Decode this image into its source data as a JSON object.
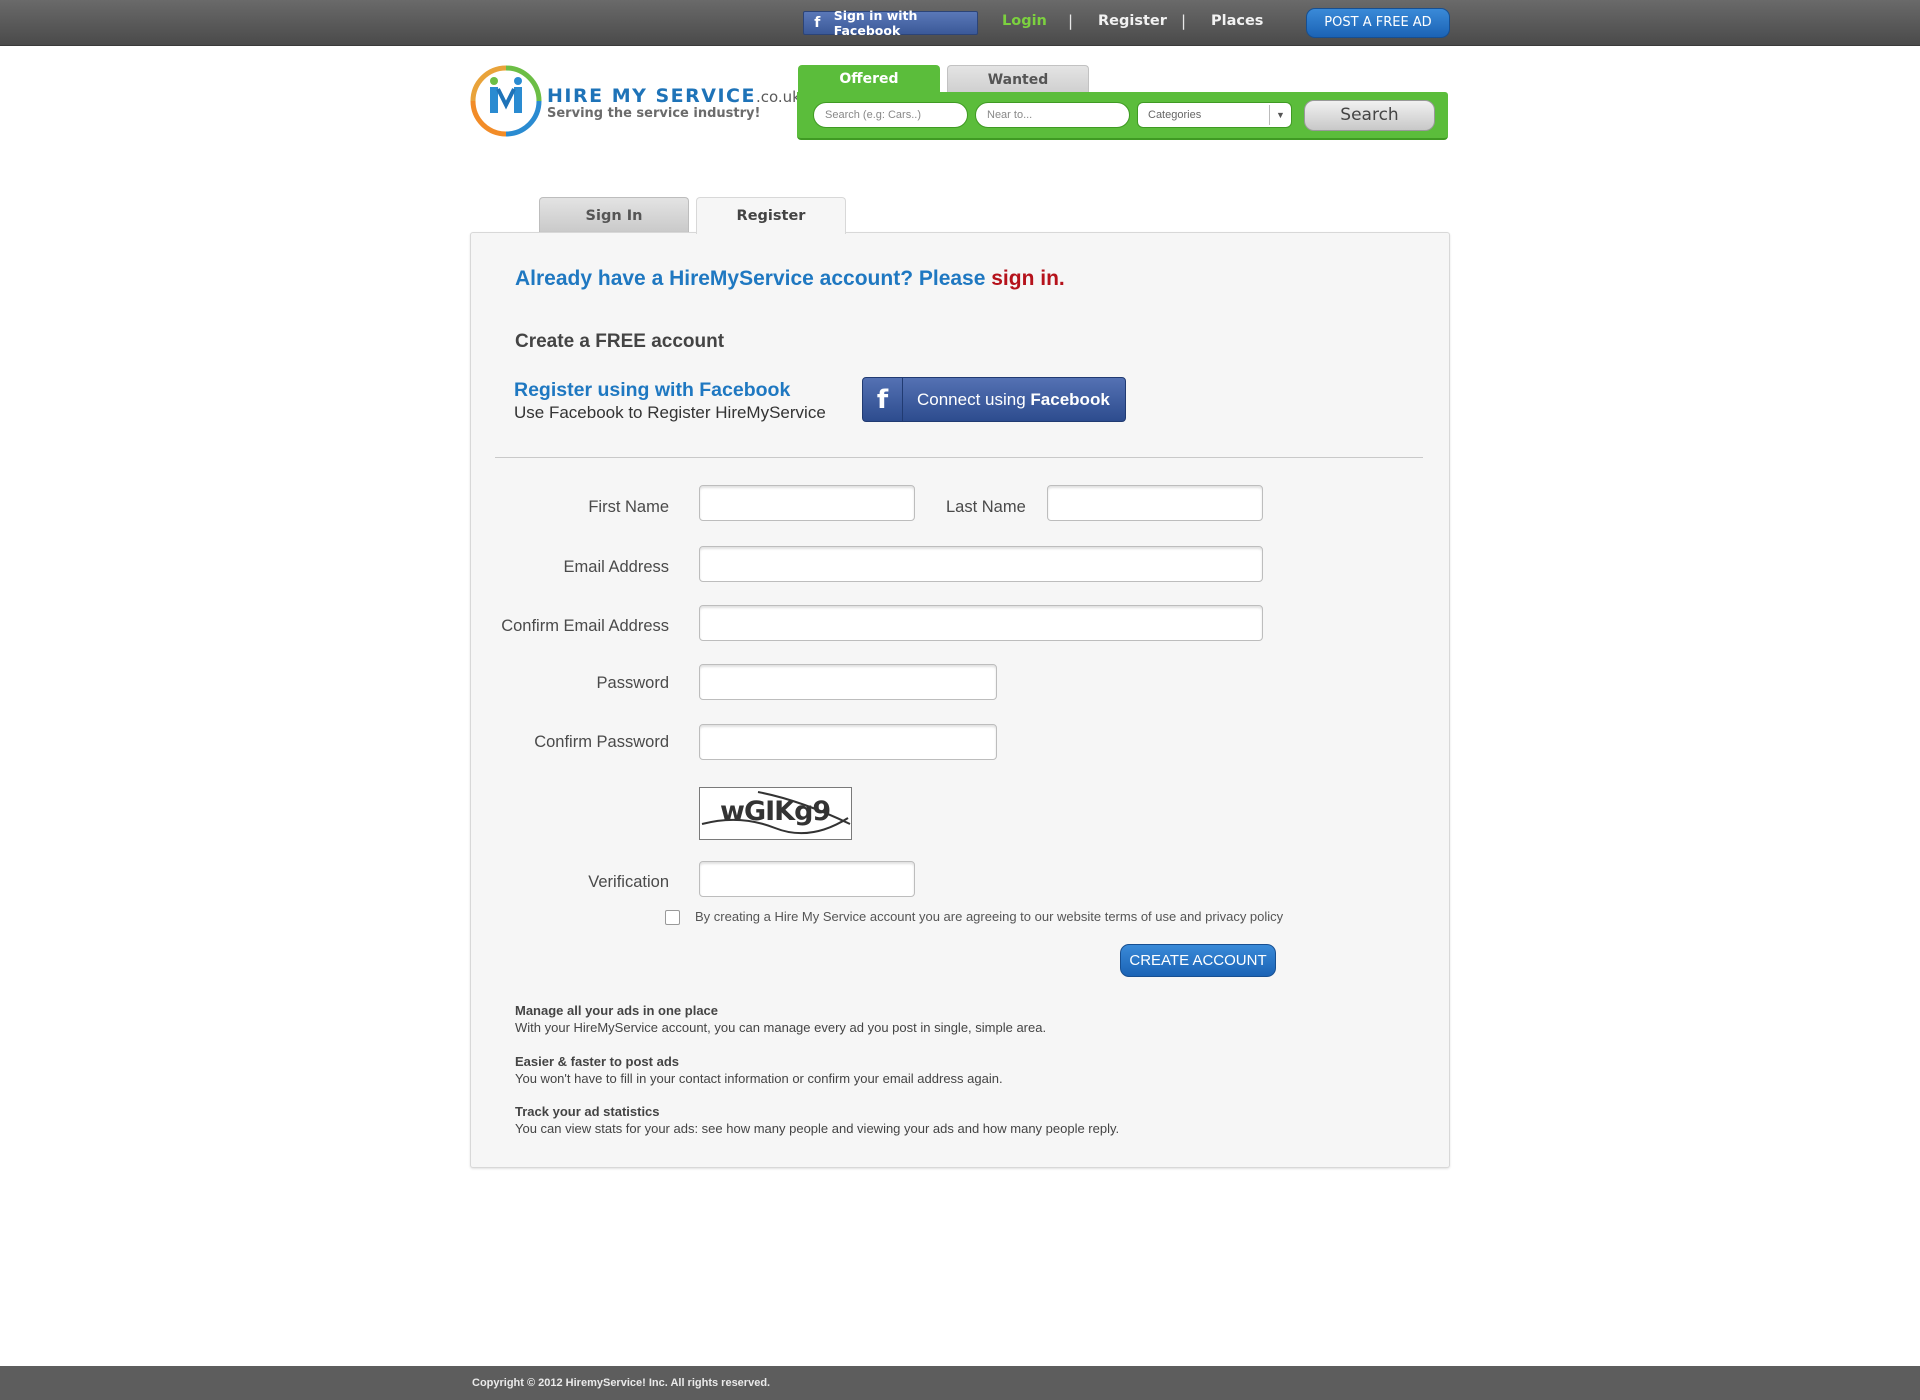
{
  "topbar": {
    "fb_signin_label": "Sign in with Facebook",
    "nav": [
      "Login",
      "Register",
      "Places"
    ],
    "separators": [
      "|",
      "|"
    ],
    "post_ad_label": "POST A FREE AD"
  },
  "logo": {
    "name": "HIRE MY SERVICE",
    "domain": ".co.uk",
    "tagline": "Serving the service industry!"
  },
  "search": {
    "tabs": [
      "Offered",
      "Wanted"
    ],
    "keyword_placeholder": "Search (e.g: Cars..)",
    "location_placeholder": "Near to...",
    "category_value": "Categories",
    "button_label": "Search"
  },
  "page_tabs": [
    "Sign In",
    "Register"
  ],
  "form": {
    "already_prefix": "Already have a HireMyService account? Please ",
    "already_link": "sign in.",
    "create_title": "Create a FREE account",
    "fb_title": "Register using with Facebook",
    "fb_subtitle": "Use Facebook to Register HireMyService",
    "fb_connect_prefix": "Connect using",
    "fb_connect_brand": "Facebook",
    "labels": {
      "first_name": "First Name",
      "last_name": "Last Name",
      "email": "Email Address",
      "confirm_email": "Confirm Email Address",
      "password": "Password",
      "confirm_password": "Confirm Password",
      "verification": "Verification"
    },
    "values": {
      "first_name": "",
      "last_name": "",
      "email": "",
      "confirm_email": "",
      "password": "",
      "confirm_password": "",
      "verification": ""
    },
    "captcha_text": "wGIKg9",
    "agree_text": "By creating a Hire My Service account you are agreeing to our website terms of use and privacy policy",
    "agree_checked": false,
    "create_button": "CREATE ACCOUNT"
  },
  "benefits": [
    {
      "title": "Manage all your ads in one place",
      "desc": "With your HireMyService account, you can manage every ad you post in single, simple area."
    },
    {
      "title": "Easier & faster to post ads",
      "desc": "You won't have to fill in your contact information or confirm your email address again."
    },
    {
      "title": "Track your ad statistics",
      "desc": "You can view stats for your ads: see how many people and viewing your ads and how many people reply."
    }
  ],
  "footer": {
    "copyright": "Copyright © 2012 HiremyService! Inc. All rights reserved."
  },
  "colors": {
    "brand_blue": "#1f78c1",
    "search_green": "#5bbd3b",
    "login_green": "#7cd13f",
    "signin_red": "#b5121b",
    "facebook_blue": "#3b5998"
  }
}
